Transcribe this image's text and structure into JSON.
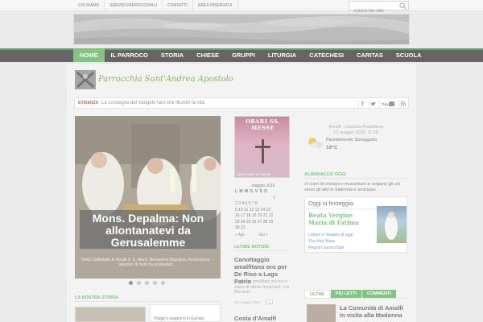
{
  "topbar": {
    "nav": [
      "CHI SIAMO",
      "SERVIZI PARROCCHIALI",
      "CONTATTI",
      "AREA RISERVATA"
    ],
    "search_placeholder": "Cerca nel sito"
  },
  "mainnav": [
    "HOME",
    "IL PARROCO",
    "STORIA",
    "CHIESE",
    "GRUPPI",
    "LITURGIA",
    "CATECHESI",
    "CARITAS",
    "SCUOLA"
  ],
  "logo": {
    "text": "Parrocchia Sant'Andrea Apostolo"
  },
  "newsbar": {
    "label": "EVIDENZA",
    "text": "La consegna del Vangelo faro che illumini la vita"
  },
  "slider": {
    "title": "Mons. Depalma: Non allontanatevi da Gerusalemme",
    "desc": "Nella Cattedrale di Amalfi S. E. Mons. Beniamino Depalma, Arcivescovo – Vescovo di Nola ha presieduto...",
    "dot_count": 5,
    "active_dot": 1
  },
  "storia": {
    "heading": "LA NOSTRA STORIA",
    "item2": "Viaggi e soggiorni in Europa"
  },
  "orari": {
    "title": "ORARI SS. MESSE",
    "subtitle": "Avvisi sacri ed eventi"
  },
  "calendar": {
    "month": "maggio 2016",
    "header": "L M M G V S D",
    "rows": [
      "1",
      "2 3 4 5 6 7 8",
      "9 10 11 12 13 14 15",
      "16 17 18 19 20 21 22",
      "23 24 25 26 27 28 29",
      "30 31"
    ],
    "prev": "« Apr",
    "next": "Giu »"
  },
  "ultime": {
    "heading": "ULTIME NOTIZIE",
    "title": "Canottaggio amalfitano oro per De Riso a Lago Patria",
    "summary": "Canottieri amalfitani ancora in odore di vittorie importanti, con Riccardo...",
    "date": "12 maggio 2016",
    "comments": "0",
    "title2": "Costa d'Amalfi piccoli"
  },
  "weather": {
    "location": "Amalfi - Costiera Amalfitana",
    "datetime": "13 maggio 2016, 11:26",
    "condition": "Parzialmente Soleggiato",
    "temp": "19°C"
  },
  "almanacco": {
    "heading": "ALMANACCO OGGI",
    "text": "«I cuori di cristiani e musulmani si volgano gli uni verso gli altri in fraternità e amicizia»",
    "box_title": "Oggi si festeggia",
    "saint": "Beata Vergine Maria di Fatima",
    "links": [
      "Letture e Vangelo di oggi",
      "The Holy Mass",
      "Registri parrocchiali"
    ]
  },
  "tabs": {
    "items": [
      "ULTIMI",
      "PIÙ LETTI",
      "COMMENTI"
    ],
    "active": 0,
    "first_title": "La Comunità di Amalfi in visita alla Madonna"
  },
  "colors": {
    "accent": "#5db65d",
    "nav_bg": "#3a3a3a",
    "page_bg": "#e6e6e6"
  }
}
